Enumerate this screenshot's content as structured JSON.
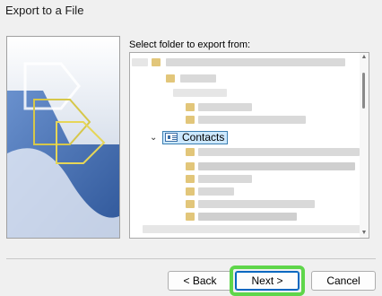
{
  "window": {
    "title": "Export to a File"
  },
  "main": {
    "folder_label": "Select folder to export from:",
    "selected_folder": "Contacts"
  },
  "buttons": {
    "back": "< Back",
    "next": "Next >",
    "cancel": "Cancel"
  },
  "colors": {
    "selection_bg": "#cce8ff",
    "selection_border": "#3c7fb1",
    "highlight_ring": "#5fd64a",
    "banner_blue": "#2f5fa8"
  }
}
